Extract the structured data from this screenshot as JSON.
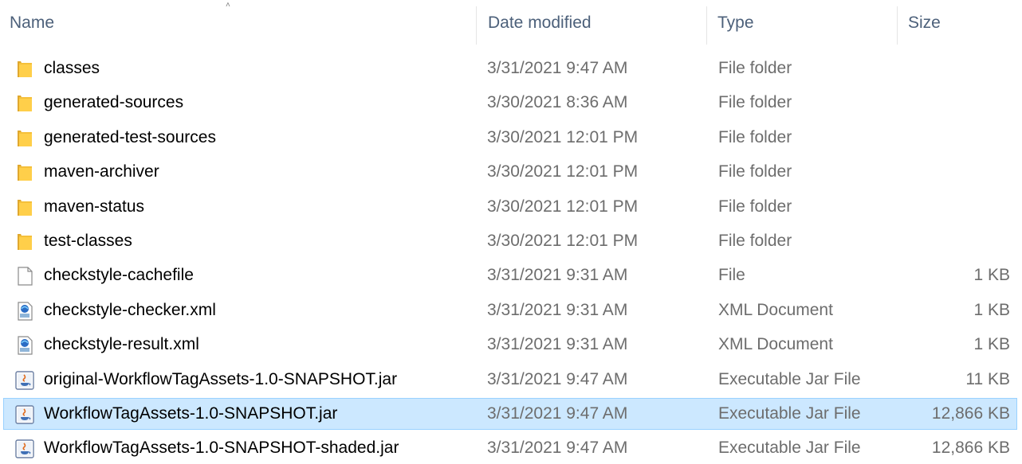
{
  "columns": {
    "name": "Name",
    "date": "Date modified",
    "type": "Type",
    "size": "Size"
  },
  "selected_index": 10,
  "files": [
    {
      "name": "classes",
      "date": "3/31/2021 9:47 AM",
      "type": "File folder",
      "size": "",
      "icon": "folder-icon"
    },
    {
      "name": "generated-sources",
      "date": "3/30/2021 8:36 AM",
      "type": "File folder",
      "size": "",
      "icon": "folder-icon"
    },
    {
      "name": "generated-test-sources",
      "date": "3/30/2021 12:01 PM",
      "type": "File folder",
      "size": "",
      "icon": "folder-icon"
    },
    {
      "name": "maven-archiver",
      "date": "3/30/2021 12:01 PM",
      "type": "File folder",
      "size": "",
      "icon": "folder-icon"
    },
    {
      "name": "maven-status",
      "date": "3/30/2021 12:01 PM",
      "type": "File folder",
      "size": "",
      "icon": "folder-icon"
    },
    {
      "name": "test-classes",
      "date": "3/30/2021 12:01 PM",
      "type": "File folder",
      "size": "",
      "icon": "folder-icon"
    },
    {
      "name": "checkstyle-cachefile",
      "date": "3/31/2021 9:31 AM",
      "type": "File",
      "size": "1 KB",
      "icon": "file-icon"
    },
    {
      "name": "checkstyle-checker.xml",
      "date": "3/31/2021 9:31 AM",
      "type": "XML Document",
      "size": "1 KB",
      "icon": "xml-icon"
    },
    {
      "name": "checkstyle-result.xml",
      "date": "3/31/2021 9:31 AM",
      "type": "XML Document",
      "size": "1 KB",
      "icon": "xml-icon"
    },
    {
      "name": "original-WorkflowTagAssets-1.0-SNAPSHOT.jar",
      "date": "3/31/2021 9:47 AM",
      "type": "Executable Jar File",
      "size": "11 KB",
      "icon": "jar-icon"
    },
    {
      "name": "WorkflowTagAssets-1.0-SNAPSHOT.jar",
      "date": "3/31/2021 9:47 AM",
      "type": "Executable Jar File",
      "size": "12,866 KB",
      "icon": "jar-icon"
    },
    {
      "name": "WorkflowTagAssets-1.0-SNAPSHOT-shaded.jar",
      "date": "3/31/2021 9:47 AM",
      "type": "Executable Jar File",
      "size": "12,866 KB",
      "icon": "jar-icon"
    }
  ]
}
